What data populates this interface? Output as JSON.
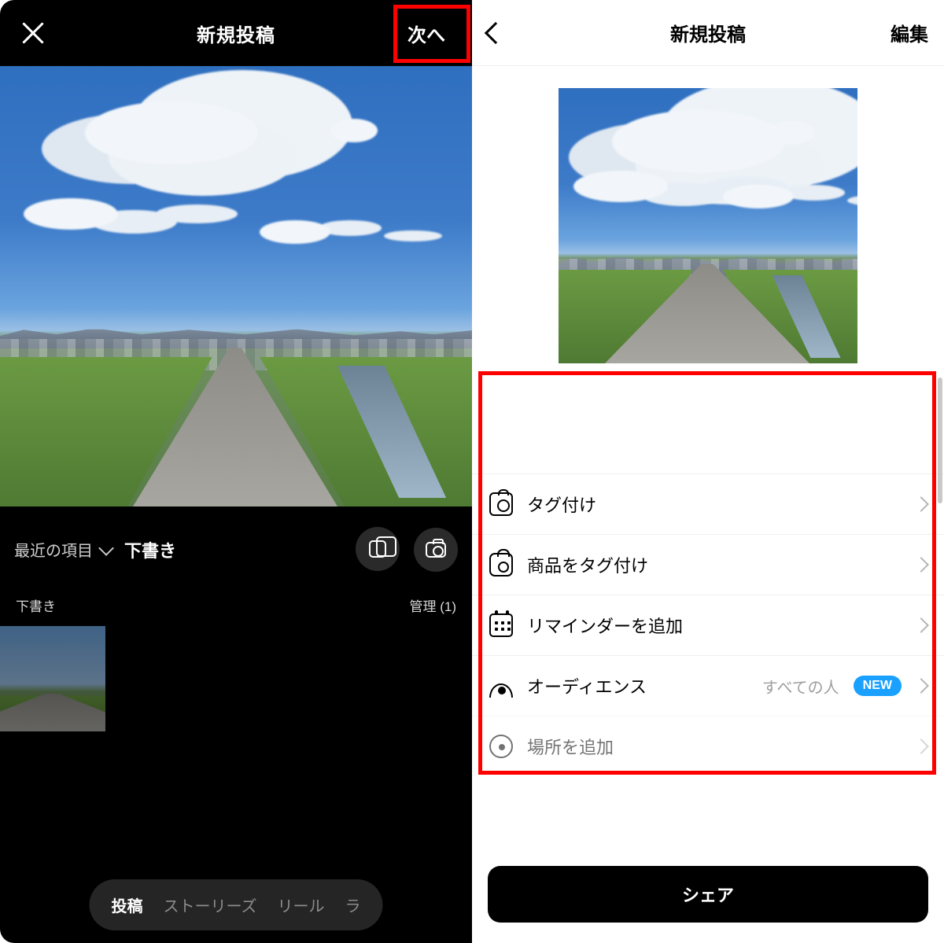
{
  "left": {
    "title": "新規投稿",
    "next": "次へ",
    "album_label": "最近の項目",
    "drafts_tab": "下書き",
    "section_drafts": "下書き",
    "manage": "管理 (1)",
    "modes": {
      "post": "投稿",
      "stories": "ストーリーズ",
      "reels": "リール",
      "live_partial": "ラ"
    }
  },
  "right": {
    "title": "新規投稿",
    "edit": "編集",
    "options": {
      "tag_people": "タグ付け",
      "tag_products": "商品をタグ付け",
      "add_reminder": "リマインダーを追加",
      "audience": "オーディエンス",
      "audience_value": "すべての人",
      "audience_badge": "NEW",
      "add_location": "場所を追加"
    },
    "share": "シェア"
  }
}
